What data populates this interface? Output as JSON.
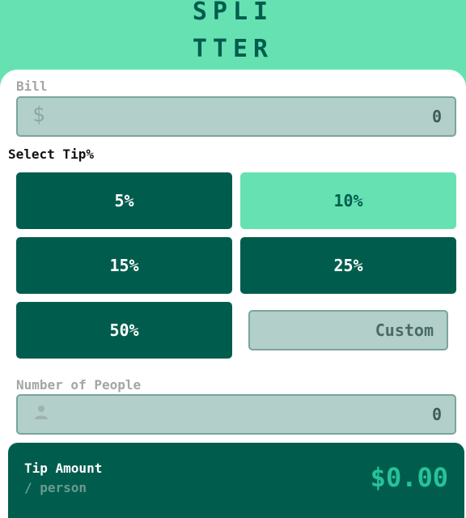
{
  "logo": {
    "line1": "SPLI",
    "line2": "TTER"
  },
  "bill": {
    "label": "Bill",
    "currency_symbol": "$",
    "value": "0",
    "icon": "dollar-icon"
  },
  "tip": {
    "label": "Select Tip%",
    "options": [
      "5%",
      "10%",
      "15%",
      "25%",
      "50%"
    ],
    "selected": "10%",
    "custom_label": "Custom"
  },
  "people": {
    "label": "Number of People",
    "value": "0",
    "icon": "person-icon"
  },
  "result": {
    "label": "Tip Amount",
    "sublabel": "/ person",
    "amount": "$0.00"
  },
  "colors": {
    "accent": "#66e2b2",
    "dark": "#005d4d",
    "input_bg": "#b3cfca",
    "amount": "#26c29a"
  }
}
